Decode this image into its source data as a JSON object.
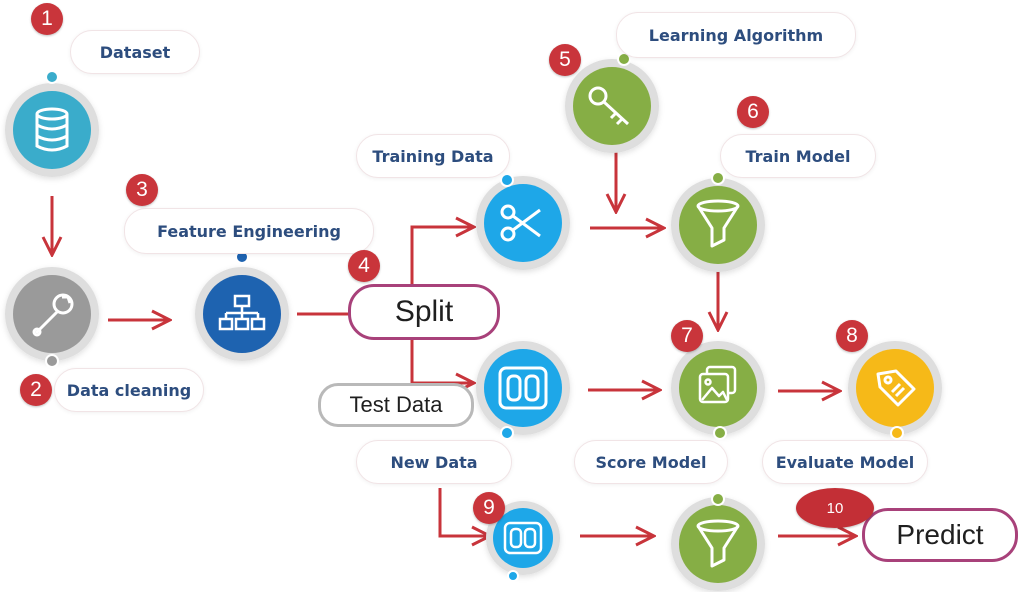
{
  "colors": {
    "arrow": "#c8343b",
    "step_badge": "#c9353b",
    "label_text": "#2d4d7e",
    "ring": "#dedede",
    "dataset": "#3aaccb",
    "cleaning": "#9a9a9a",
    "feature": "#1e63b0",
    "blue_node": "#1ea7e8",
    "green_node": "#86ae45",
    "yellow_node": "#f6b918",
    "split_border": "#a8417a",
    "test_border": "#b9b9b9"
  },
  "steps": [
    "1",
    "2",
    "3",
    "4",
    "5",
    "6",
    "7",
    "8",
    "9",
    "10"
  ],
  "labels": {
    "dataset": "Dataset",
    "data_cleaning": "Data cleaning",
    "feature_engineering": "Feature Engineering",
    "split": "Split",
    "training_data": "Training Data",
    "test_data": "Test Data",
    "new_data": "New Data",
    "learning_algorithm": "Learning Algorithm",
    "train_model": "Train Model",
    "score_model": "Score Model",
    "evaluate_model": "Evaluate Model",
    "predict": "Predict"
  },
  "icons": {
    "dataset": "database-icon",
    "data_cleaning": "wrench-icon",
    "feature_engineering": "hierarchy-icon",
    "training_data": "scissors-icon",
    "test_data": "switch-panel-icon",
    "new_data": "switch-panel-icon",
    "learning_algorithm": "key-icon",
    "train_model": "funnel-icon",
    "score_model": "image-stack-icon",
    "evaluate_model": "tag-icon",
    "predict": "funnel-icon"
  }
}
